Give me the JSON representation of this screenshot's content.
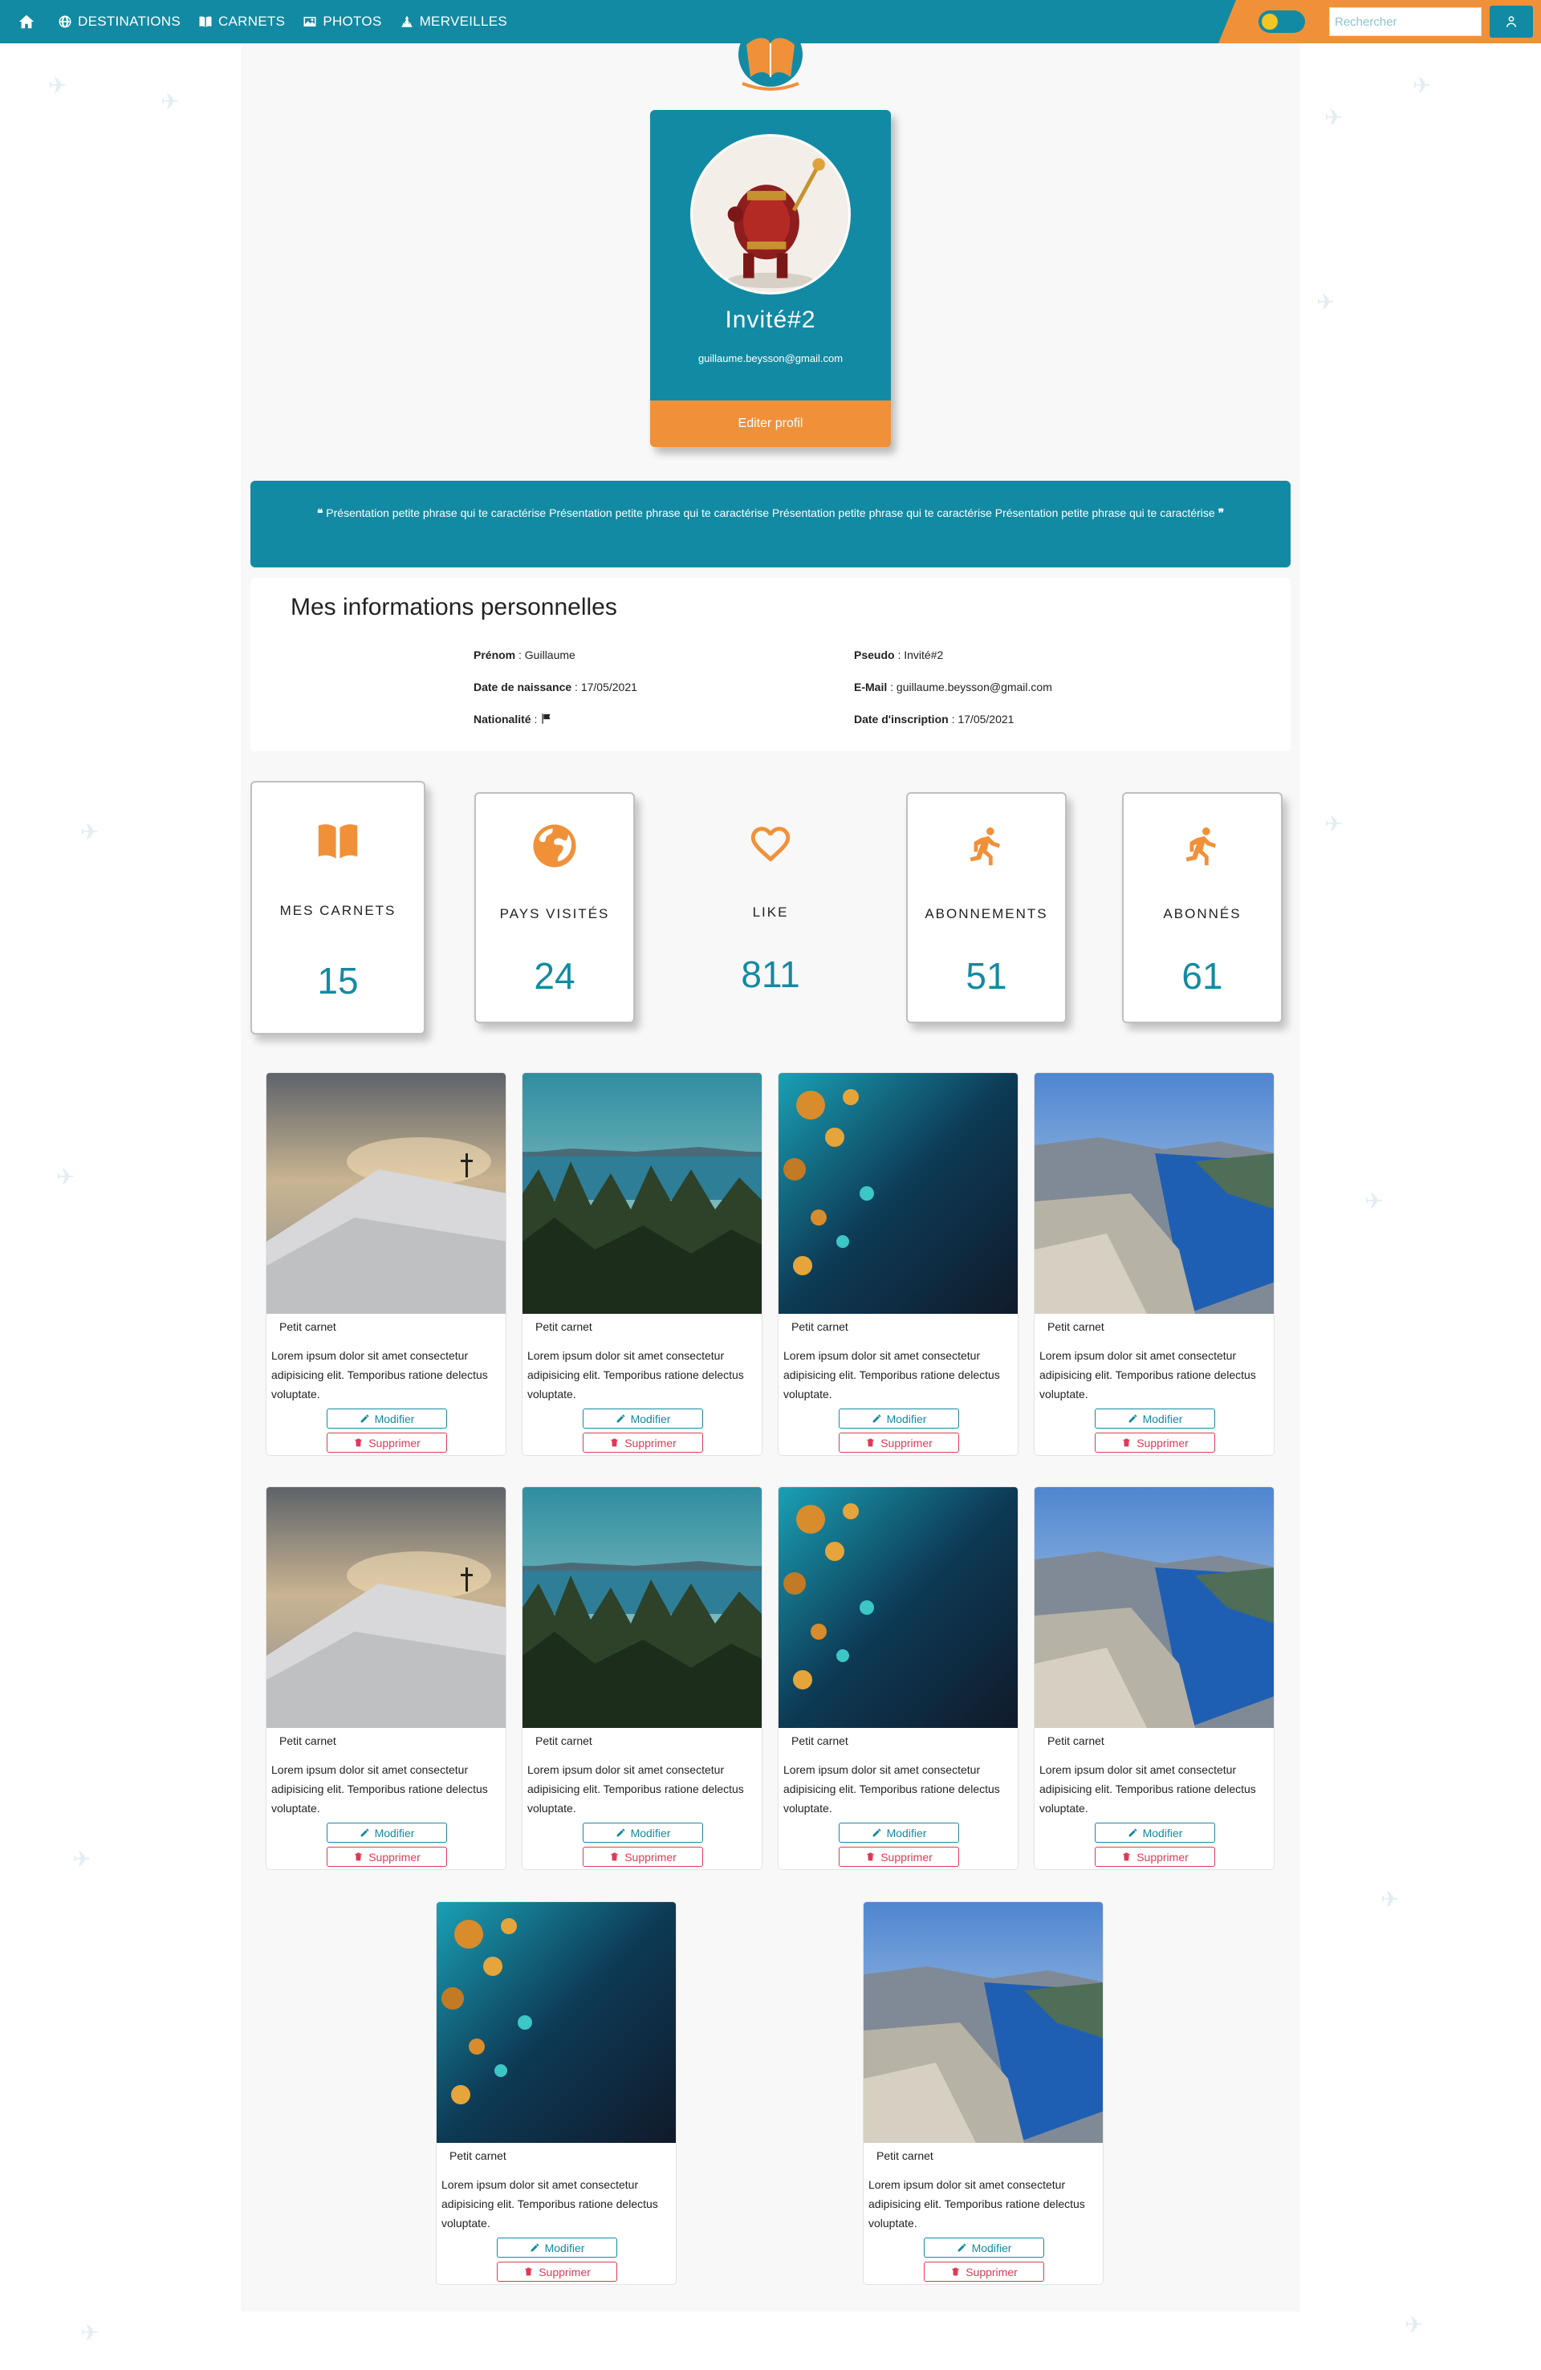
{
  "nav": {
    "items": [
      {
        "label": "DESTINATIONS",
        "icon": "globe-icon"
      },
      {
        "label": "CARNETS",
        "icon": "book-icon"
      },
      {
        "label": "PHOTOS",
        "icon": "image-icon"
      },
      {
        "label": "MERVEILLES",
        "icon": "monument-icon"
      }
    ],
    "search_placeholder": "Rechercher"
  },
  "colors": {
    "primary": "#138aa3",
    "accent": "#f0913a",
    "danger": "#e03a55"
  },
  "profile": {
    "name": "Invité#2",
    "email": "guillaume.beysson@gmail.com",
    "edit_label": "Editer profil"
  },
  "quote": {
    "text": "Présentation petite phrase qui te caractérise Présentation petite phrase qui te caractérise Présentation petite phrase qui te caractérise Présentation petite phrase qui te caractérise"
  },
  "info": {
    "title": "Mes informations personnelles",
    "prenom_label": "Prénom",
    "prenom": "Guillaume",
    "pseudo_label": "Pseudo",
    "pseudo": "Invité#2",
    "naissance_label": "Date de naissance",
    "naissance": "17/05/2021",
    "email_label": "E-Mail",
    "email": "guillaume.beysson@gmail.com",
    "nationalite_label": "Nationalité",
    "inscription_label": "Date d'inscription",
    "inscription": "17/05/2021"
  },
  "stats": [
    {
      "label": "MES CARNETS",
      "value": "15",
      "icon": "book-icon"
    },
    {
      "label": "PAYS VISITÉS",
      "value": "24",
      "icon": "earth-icon"
    },
    {
      "label": "LIKE",
      "value": "811",
      "icon": "heart-icon"
    },
    {
      "label": "ABONNEMENTS",
      "value": "51",
      "icon": "running-icon"
    },
    {
      "label": "ABONNÉS",
      "value": "61",
      "icon": "running-icon"
    }
  ],
  "carnets": [
    {
      "title": "Petit carnet",
      "desc": "Lorem ipsum dolor sit amet consectetur adipisicing elit. Temporibus ratione delectus voluptate.",
      "image": "snow-mountain-cross"
    },
    {
      "title": "Petit carnet",
      "desc": "Lorem ipsum dolor sit amet consectetur adipisicing elit. Temporibus ratione delectus voluptate.",
      "image": "forest-lake"
    },
    {
      "title": "Petit carnet",
      "desc": "Lorem ipsum dolor sit amet consectetur adipisicing elit. Temporibus ratione delectus voluptate.",
      "image": "ocean-aerial"
    },
    {
      "title": "Petit carnet",
      "desc": "Lorem ipsum dolor sit amet consectetur adipisicing elit. Temporibus ratione delectus voluptate.",
      "image": "fjord-cliff"
    },
    {
      "title": "Petit carnet",
      "desc": "Lorem ipsum dolor sit amet consectetur adipisicing elit. Temporibus ratione delectus voluptate.",
      "image": "snow-mountain-cross"
    },
    {
      "title": "Petit carnet",
      "desc": "Lorem ipsum dolor sit amet consectetur adipisicing elit. Temporibus ratione delectus voluptate.",
      "image": "forest-lake"
    },
    {
      "title": "Petit carnet",
      "desc": "Lorem ipsum dolor sit amet consectetur adipisicing elit. Temporibus ratione delectus voluptate.",
      "image": "ocean-aerial"
    },
    {
      "title": "Petit carnet",
      "desc": "Lorem ipsum dolor sit amet consectetur adipisicing elit. Temporibus ratione delectus voluptate.",
      "image": "fjord-cliff"
    },
    {
      "title": "Petit carnet",
      "desc": "Lorem ipsum dolor sit amet consectetur adipisicing elit. Temporibus ratione delectus voluptate.",
      "image": "ocean-aerial"
    },
    {
      "title": "Petit carnet",
      "desc": "Lorem ipsum dolor sit amet consectetur adipisicing elit. Temporibus ratione delectus voluptate.",
      "image": "fjord-cliff"
    }
  ],
  "buttons": {
    "modify": "Modifier",
    "delete": "Supprimer"
  }
}
